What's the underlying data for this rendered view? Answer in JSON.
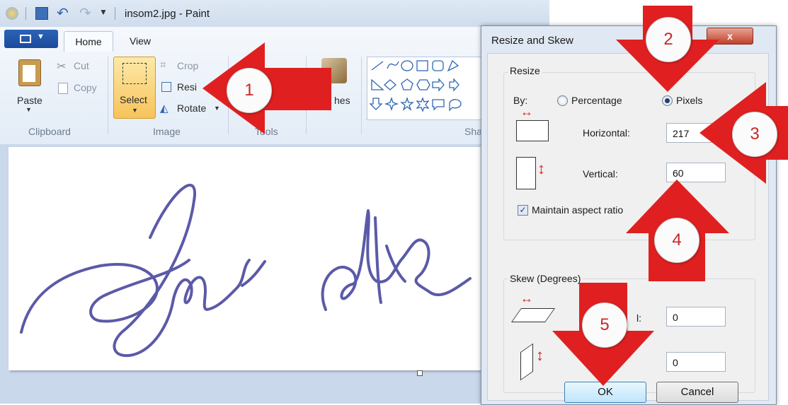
{
  "window": {
    "title": "insom2.jpg - Paint"
  },
  "ribbon": {
    "tabs": [
      "Home",
      "View"
    ],
    "clipboard": {
      "paste": "Paste",
      "cut": "Cut",
      "copy": "Copy",
      "group": "Clipboard"
    },
    "image": {
      "crop": "Crop",
      "resize": "Resi",
      "rotate": "Rotate",
      "select": "Select",
      "group": "Image"
    },
    "tools_group": "Tools",
    "brushes": "hes",
    "shapes_group": "Sha"
  },
  "dialog": {
    "title": "Resize and Skew",
    "close": "x",
    "resize": {
      "legend": "Resize",
      "by": "By:",
      "percentage": "Percentage",
      "pixels": "Pixels",
      "horizontal_label": "Horizontal:",
      "horizontal_value": "217",
      "vertical_label": "Vertical:",
      "vertical_value": "60",
      "maintain": "Maintain aspect ratio"
    },
    "skew": {
      "legend": "Skew (Degrees)",
      "horizontal_label": "l:",
      "horizontal_value": "0",
      "vertical_value": "0"
    },
    "ok": "OK",
    "cancel": "Cancel"
  },
  "annotations": [
    "1",
    "2",
    "3",
    "4",
    "5"
  ],
  "colors": {
    "arrow": "#e02020",
    "ink": "#5b5aa8"
  }
}
